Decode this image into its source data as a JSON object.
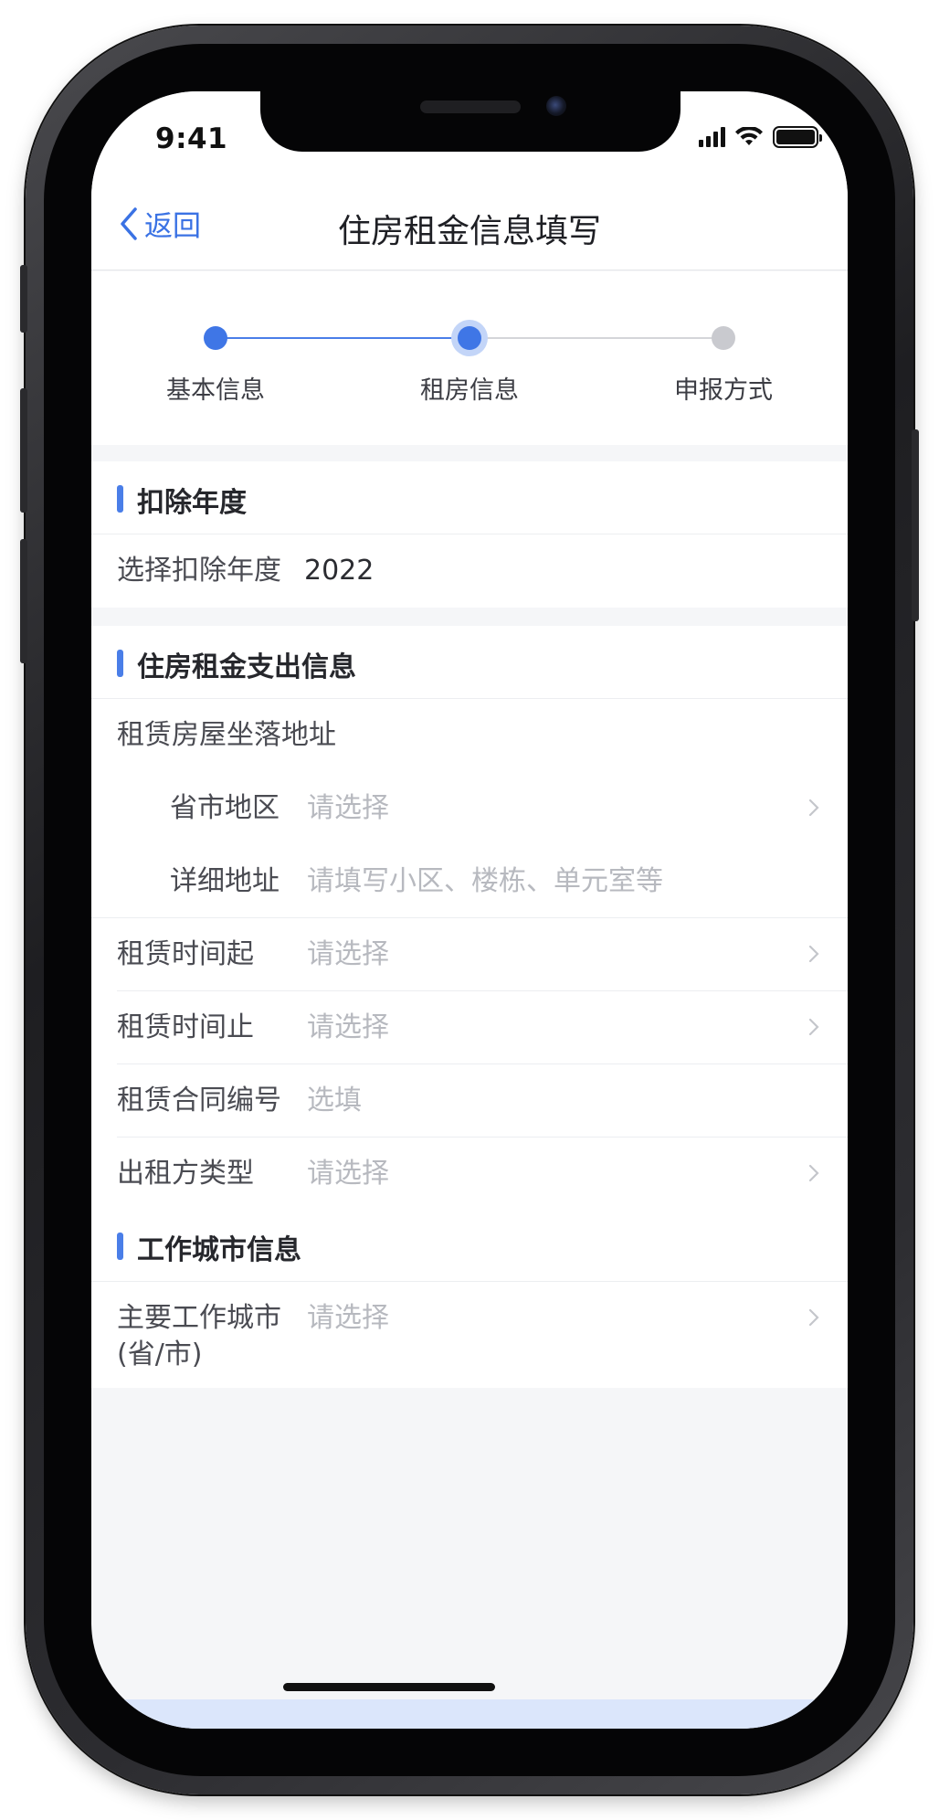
{
  "status_bar": {
    "time": "9:41"
  },
  "nav": {
    "back_label": "返回",
    "title": "住房租金信息填写"
  },
  "stepper": {
    "steps": [
      {
        "label": "基本信息",
        "state": "done"
      },
      {
        "label": "租房信息",
        "state": "current"
      },
      {
        "label": "申报方式",
        "state": "todo"
      }
    ]
  },
  "sections": {
    "deduction_year": {
      "title": "扣除年度",
      "year_label": "选择扣除年度",
      "year_value": "2022"
    },
    "rent_info": {
      "title": "住房租金支出信息",
      "address_label": "租赁房屋坐落地址",
      "province_label": "省市地区",
      "province_placeholder": "请选择",
      "detail_label": "详细地址",
      "detail_placeholder": "请填写小区、楼栋、单元室等",
      "start_label": "租赁时间起",
      "start_placeholder": "请选择",
      "end_label": "租赁时间止",
      "end_placeholder": "请选择",
      "contract_label": "租赁合同编号",
      "contract_placeholder": "选填",
      "landlord_label": "出租方类型",
      "landlord_placeholder": "请选择"
    },
    "work_city": {
      "title": "工作城市信息",
      "city_label_line1": "主要工作城市",
      "city_label_line2": "(省/市)",
      "city_placeholder": "请选择"
    }
  },
  "colors": {
    "accent": "#3f76e6",
    "placeholder": "#b7b9bf",
    "text": "#4a4b52"
  }
}
